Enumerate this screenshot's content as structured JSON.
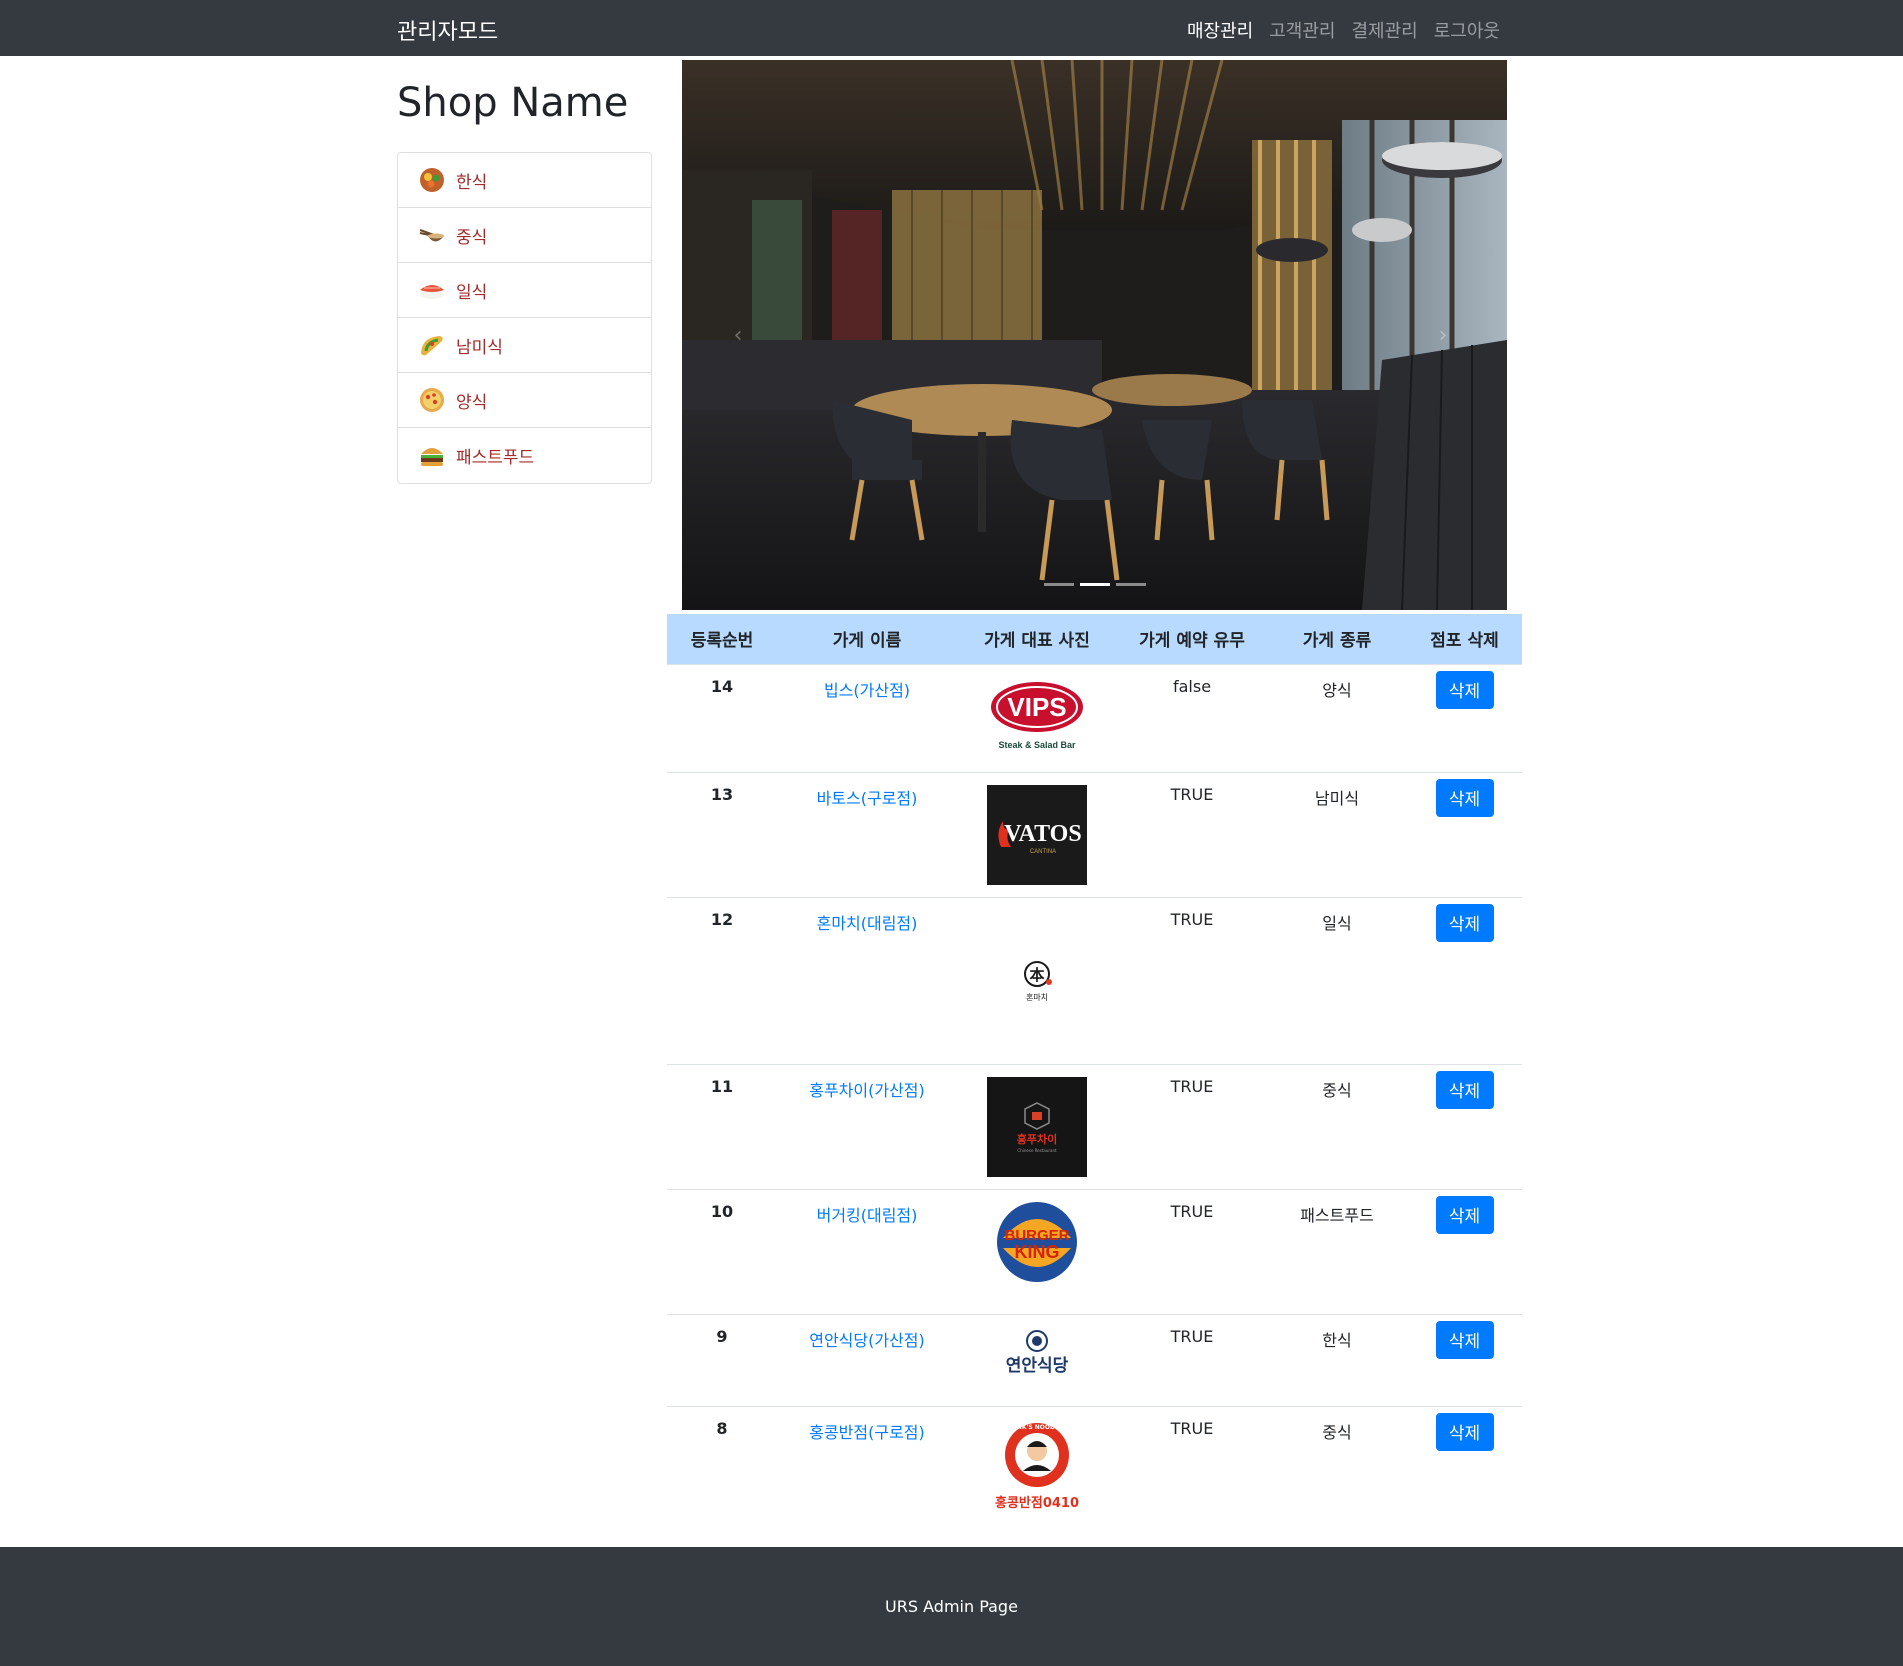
{
  "navbar": {
    "brand": "관리자모드",
    "links": [
      {
        "label": "매장관리",
        "active": true
      },
      {
        "label": "고객관리",
        "active": false
      },
      {
        "label": "결제관리",
        "active": false
      },
      {
        "label": "로그아웃",
        "active": false
      }
    ]
  },
  "sidebar": {
    "title": "Shop Name",
    "categories": [
      {
        "label": "한식",
        "icon": "bibimbap-icon"
      },
      {
        "label": "중식",
        "icon": "noodles-icon"
      },
      {
        "label": "일식",
        "icon": "sushi-icon"
      },
      {
        "label": "남미식",
        "icon": "taco-icon"
      },
      {
        "label": "양식",
        "icon": "pizza-icon"
      },
      {
        "label": "패스트푸드",
        "icon": "burger-icon"
      }
    ]
  },
  "carousel": {
    "slides": 3,
    "active_index": 1
  },
  "table": {
    "headers": [
      "등록순번",
      "가게 이름",
      "가게 대표 사진",
      "가게 예약 유무",
      "가게 종류",
      "점포 삭제"
    ],
    "delete_label": "삭제",
    "rows": [
      {
        "no": "14",
        "name": "빕스(가산점)",
        "logo": "vips-logo",
        "logo_text": "VIPS",
        "logo_sub": "Steak & Salad Bar",
        "reserve": "false",
        "type": "양식"
      },
      {
        "no": "13",
        "name": "바토스(구로점)",
        "logo": "vatos-logo",
        "logo_text": "VATOS",
        "logo_sub": "CANTINA",
        "reserve": "TRUE",
        "type": "남미식"
      },
      {
        "no": "12",
        "name": "혼마치(대림점)",
        "logo": "honmachi-logo",
        "logo_text": "本",
        "logo_sub": "혼마치",
        "reserve": "TRUE",
        "type": "일식"
      },
      {
        "no": "11",
        "name": "홍푸차이(가산점)",
        "logo": "hongpuchai-logo",
        "logo_text": "홍푸차이",
        "logo_sub": "Chinese Restaurant",
        "reserve": "TRUE",
        "type": "중식"
      },
      {
        "no": "10",
        "name": "버거킹(대림점)",
        "logo": "burgerking-logo",
        "logo_text": "BURGER",
        "logo_sub": "KING",
        "reserve": "TRUE",
        "type": "패스트푸드"
      },
      {
        "no": "9",
        "name": "연안식당(가산점)",
        "logo": "yeonan-logo",
        "logo_text": "연안식당",
        "logo_sub": "",
        "reserve": "TRUE",
        "type": "한식"
      },
      {
        "no": "8",
        "name": "홍콩반점(구로점)",
        "logo": "hongkong-logo",
        "logo_text": "홍콩반점0410",
        "logo_sub": "PAIK'S NOODLE",
        "reserve": "TRUE",
        "type": "중식"
      }
    ]
  },
  "footer": {
    "text": "URS Admin Page"
  },
  "colors": {
    "navbar_bg": "#343a40",
    "table_header_bg": "#b8daff",
    "primary": "#007bff",
    "category_text": "#a52a2a"
  }
}
